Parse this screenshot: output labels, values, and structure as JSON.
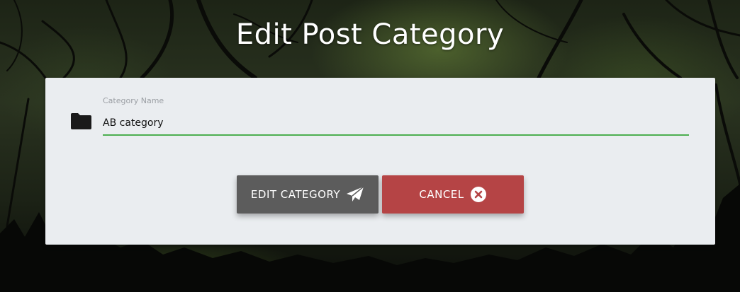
{
  "page": {
    "title": "Edit Post Category"
  },
  "form": {
    "field_label": "Category Name",
    "field_value": "AB category",
    "field_icon": "folder-icon"
  },
  "buttons": {
    "edit_label": "EDIT CATEGORY",
    "edit_icon": "paper-plane-icon",
    "cancel_label": "CANCEL",
    "cancel_icon": "close-circle-icon"
  },
  "colors": {
    "accent_underline": "#4caf50",
    "edit_button": "#5c5c5c",
    "cancel_button": "#b54445",
    "card_background": "#eaedf0"
  }
}
